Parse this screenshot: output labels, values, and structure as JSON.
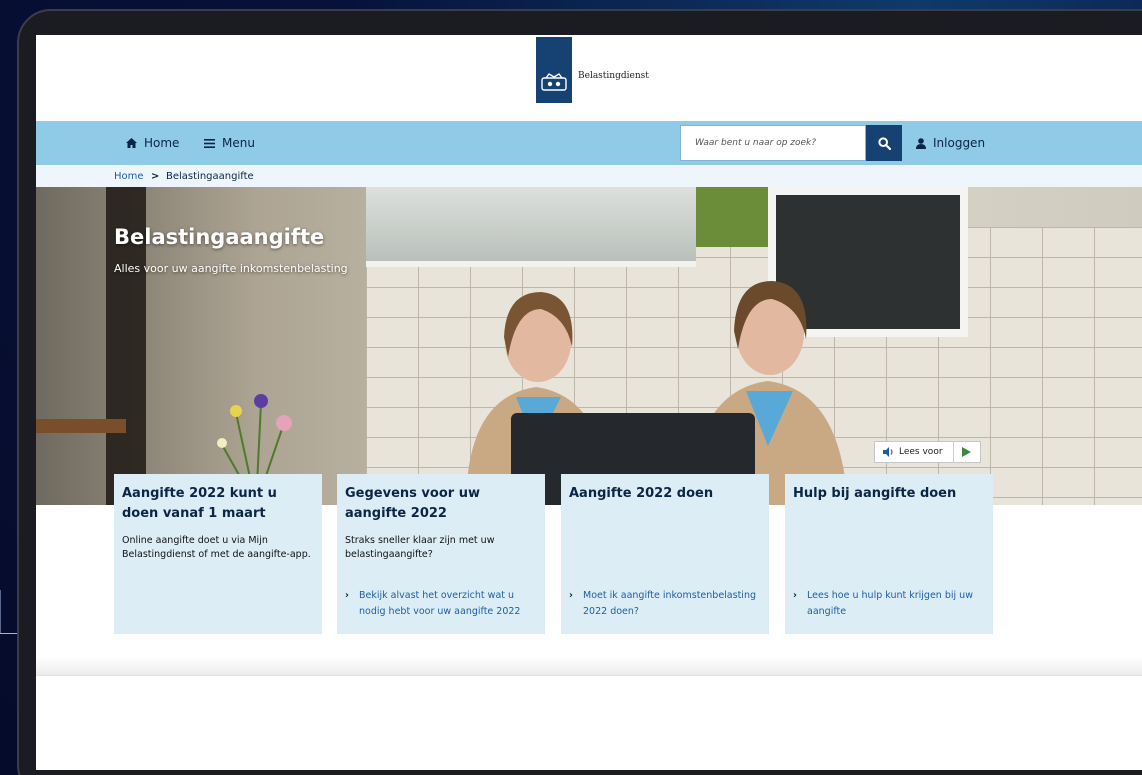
{
  "brand": {
    "name": "Belastingdienst"
  },
  "nav": {
    "home_label": "Home",
    "menu_label": "Menu",
    "search_placeholder": "Waar bent u naar op zoek?",
    "login_label": "Inloggen"
  },
  "breadcrumb": {
    "home": "Home",
    "separator": ">",
    "current": "Belastingaangifte"
  },
  "hero": {
    "title": "Belastingaangifte",
    "subtitle": "Alles voor uw aangifte inkomstenbelasting"
  },
  "read_aloud": {
    "label": "Lees voor"
  },
  "cards": [
    {
      "title": "Aangifte 2022 kunt u doen vanaf 1 maart",
      "text": "Online aangifte doet u via Mijn Belastingdienst of met de aangifte-app.",
      "link": ""
    },
    {
      "title": "Gegevens voor uw aangifte 2022",
      "text": "Straks sneller klaar zijn met uw belastingaangifte?",
      "link": "Bekijk alvast het overzicht wat u nodig hebt voor uw aangifte 2022"
    },
    {
      "title": "Aangifte 2022 doen",
      "text": "",
      "link": "Moet ik aangifte inkomstenbelasting 2022 doen?"
    },
    {
      "title": "Hulp bij aangifte doen",
      "text": "",
      "link": "Lees hoe u hulp kunt krijgen bij uw aangifte"
    }
  ],
  "colors": {
    "brand_blue": "#154273",
    "nav_blue": "#8fcae7",
    "card_bg": "#dcedf6",
    "link_blue": "#1b5fa6"
  }
}
